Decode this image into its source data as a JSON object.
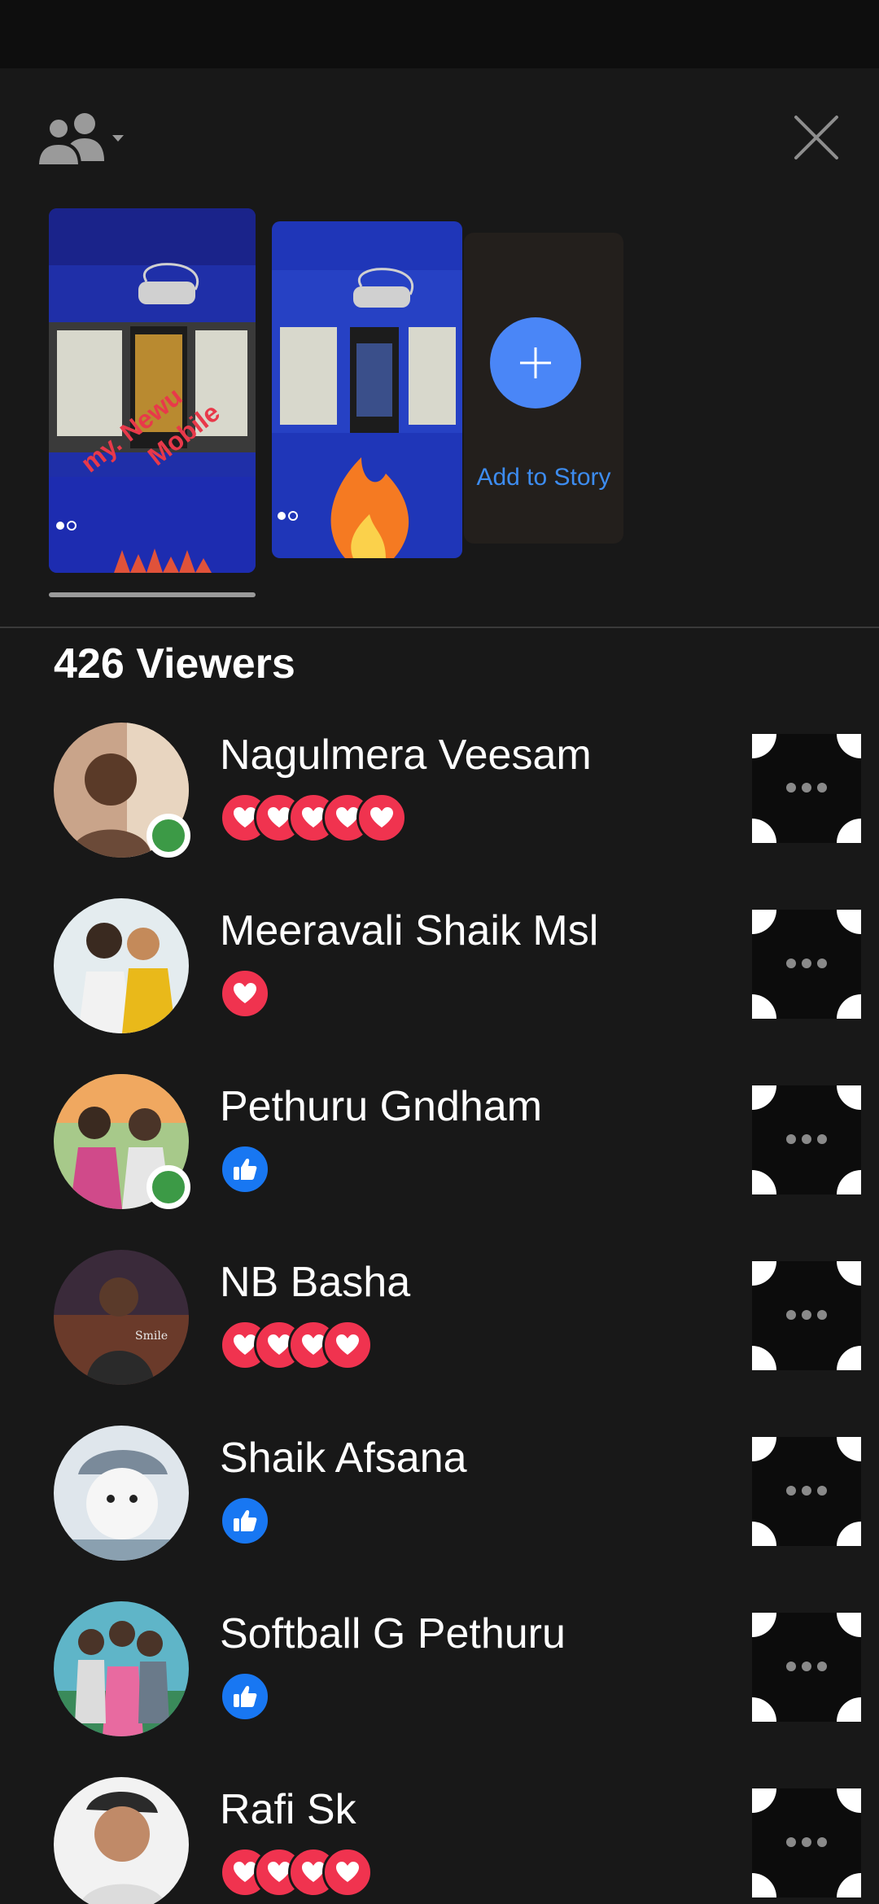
{
  "header": {
    "audience_icon": "people-icon",
    "close_icon": "close-icon"
  },
  "stories": {
    "add_label": "Add to Story",
    "add_icon": "plus-icon",
    "items": [
      {
        "overlay_line1": "my. Newu",
        "overlay_line2": "Mobile"
      },
      {
        "overlay_icon": "fire-emoji"
      }
    ]
  },
  "viewers": {
    "count_label": "426 Viewers",
    "list": [
      {
        "name": "Nagulmera Veesam",
        "online": true,
        "reactions": [
          "love",
          "love",
          "love",
          "love",
          "love"
        ]
      },
      {
        "name": "Meeravali Shaik Msl",
        "online": false,
        "reactions": [
          "love"
        ]
      },
      {
        "name": "Pethuru Gndham",
        "online": true,
        "reactions": [
          "like"
        ]
      },
      {
        "name": "NB Basha",
        "online": false,
        "reactions": [
          "love",
          "love",
          "love",
          "love"
        ]
      },
      {
        "name": "Shaik Afsana",
        "online": false,
        "reactions": [
          "like"
        ]
      },
      {
        "name": "Softball G Pethuru",
        "online": false,
        "reactions": [
          "like"
        ]
      },
      {
        "name": "Rafi Sk",
        "online": false,
        "reactions": [
          "love",
          "love",
          "love",
          "love"
        ]
      }
    ]
  },
  "colors": {
    "background": "#181818",
    "accent": "#4a86f7",
    "love": "#f0334f",
    "like": "#1877f2",
    "online": "#3c9a46"
  }
}
